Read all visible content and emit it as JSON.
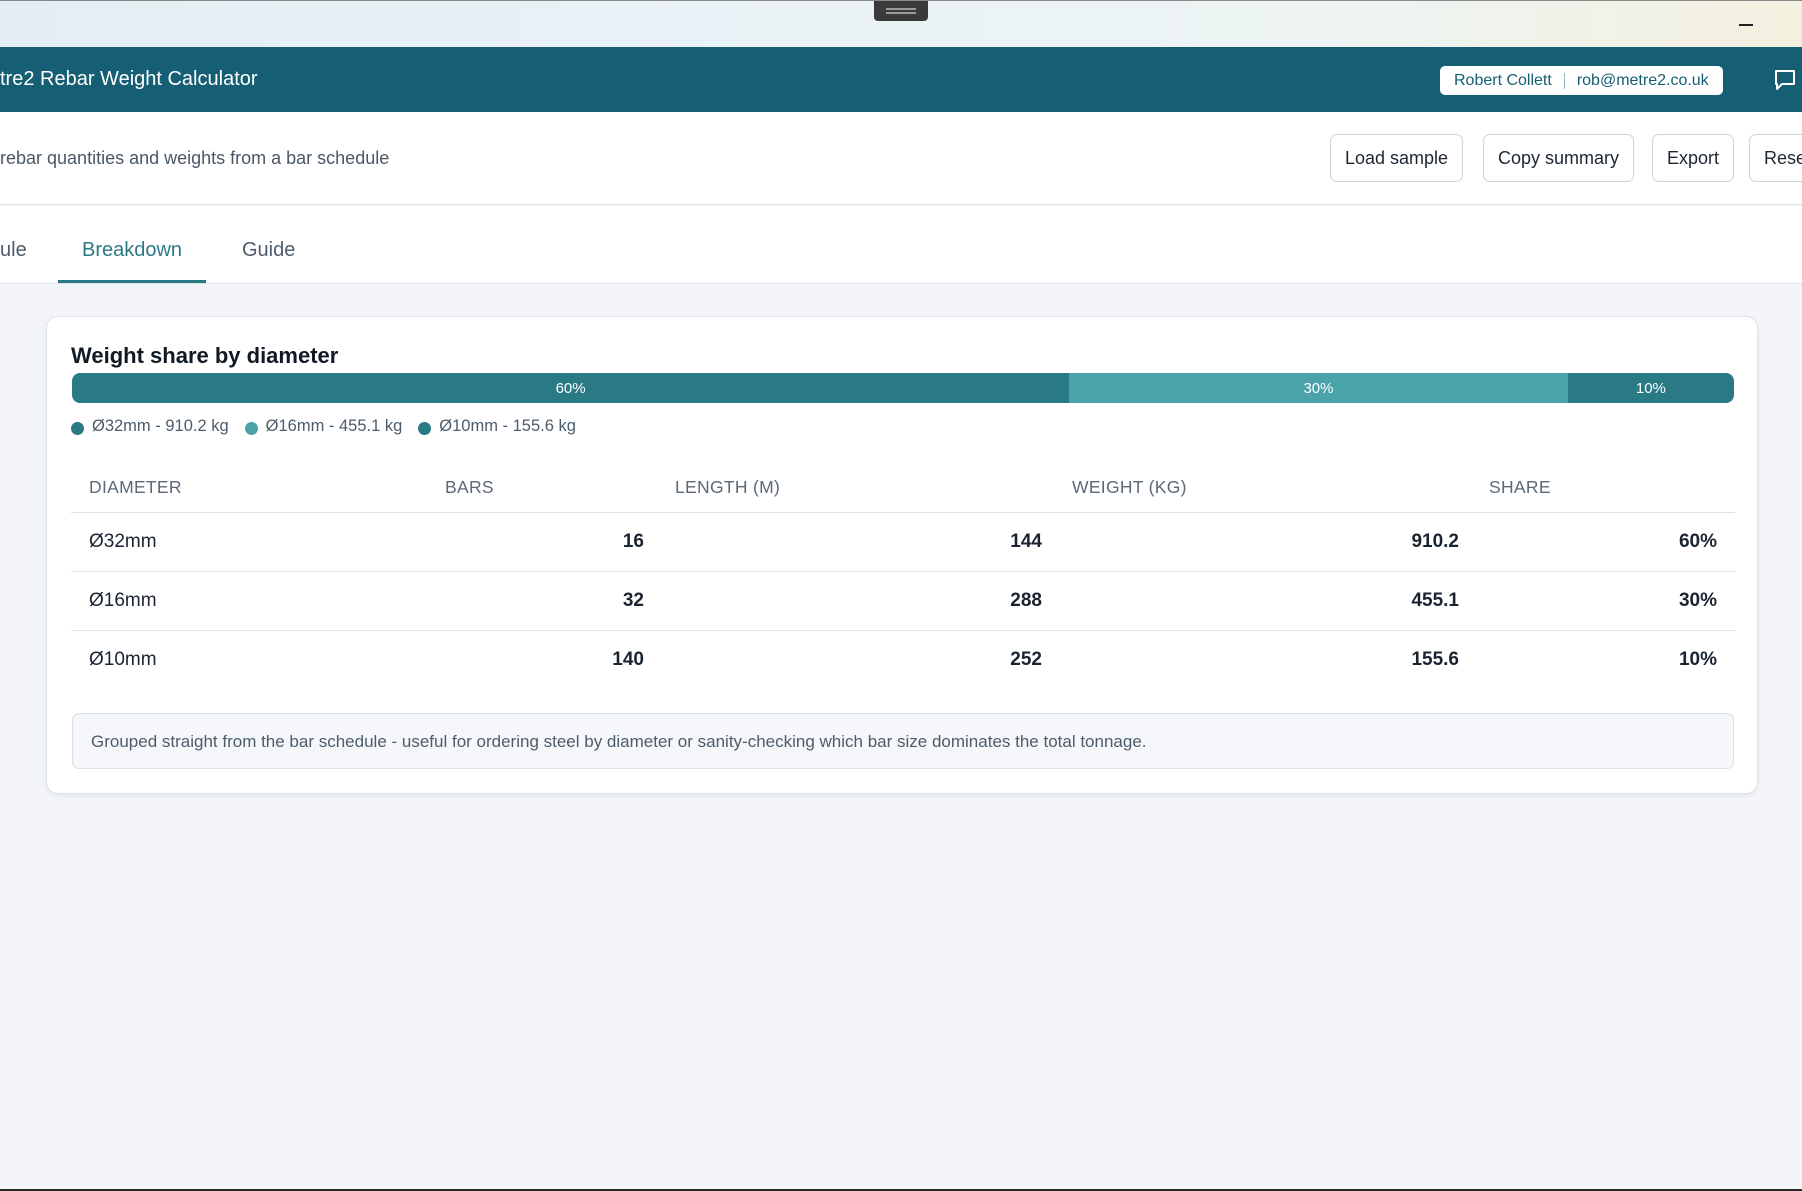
{
  "window": {
    "drag_handle_icon": "drag-handle-icon",
    "minimize_icon": "minimize-icon"
  },
  "header": {
    "app_title": "tre2 Rebar Weight Calculator",
    "user_name": "Robert Collett",
    "user_email": "rob@metre2.co.uk",
    "chat_icon": "chat-bubble-icon",
    "background_color": "#165e73"
  },
  "subheader": {
    "subtitle": "rebar quantities and weights from a bar schedule",
    "buttons": {
      "load_sample": "Load sample",
      "copy_summary": "Copy summary",
      "export": "Export",
      "reset": "Rese"
    }
  },
  "tabs": [
    {
      "label": "ule",
      "active": false
    },
    {
      "label": "Breakdown",
      "active": true
    },
    {
      "label": "Guide",
      "active": false
    }
  ],
  "card": {
    "title": "Weight share by diameter",
    "share_bar": [
      {
        "label": "60%",
        "share": 60,
        "color": "#2a7a86"
      },
      {
        "label": "30%",
        "share": 30,
        "color": "#4aa3a9"
      },
      {
        "label": "10%",
        "share": 10,
        "color": "#2a7a86"
      }
    ],
    "legend": [
      {
        "label": "Ø32mm - 910.2 kg",
        "color": "#2a7a86"
      },
      {
        "label": "Ø16mm - 455.1 kg",
        "color": "#4aa3a9"
      },
      {
        "label": "Ø10mm - 155.6 kg",
        "color": "#2a7a86"
      }
    ],
    "table": {
      "columns": [
        "DIAMETER",
        "BARS",
        "LENGTH (M)",
        "WEIGHT (KG)",
        "SHARE"
      ],
      "rows": [
        {
          "diameter": "Ø32mm",
          "bars": "16",
          "length": "144",
          "weight": "910.2",
          "share": "60%"
        },
        {
          "diameter": "Ø16mm",
          "bars": "32",
          "length": "288",
          "weight": "455.1",
          "share": "30%"
        },
        {
          "diameter": "Ø10mm",
          "bars": "140",
          "length": "252",
          "weight": "155.6",
          "share": "10%"
        }
      ]
    },
    "note": "Grouped straight from the bar schedule - useful for ordering steel by diameter or sanity-checking which bar size dominates the total tonnage."
  }
}
